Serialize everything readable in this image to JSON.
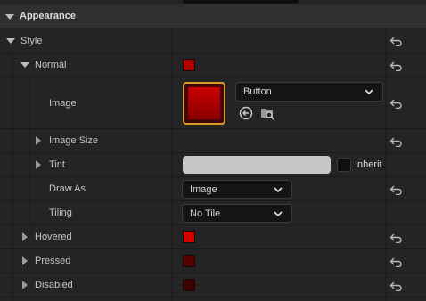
{
  "category": {
    "title": "Appearance"
  },
  "rows": {
    "style": "Style",
    "normal": "Normal",
    "image": "Image",
    "image_size": "Image Size",
    "tint": "Tint",
    "draw_as": "Draw As",
    "tiling": "Tiling",
    "hovered": "Hovered",
    "pressed": "Pressed",
    "disabled": "Disabled"
  },
  "image_asset": {
    "selected": "Button"
  },
  "draw_as": {
    "value": "Image"
  },
  "tiling": {
    "value": "No Tile"
  },
  "tint": {
    "inherit_label": "Inherit",
    "color": "#c7c7c7"
  },
  "swatches": {
    "normal": "#b30000",
    "hovered": "#d40000",
    "pressed": "#560000",
    "disabled": "#3f0000"
  },
  "icons": {
    "reset": "reset-arrow-icon",
    "browse": "browse-to-asset-icon",
    "find": "find-in-content-browser-icon",
    "expand": "expand-arrow-icon",
    "collapse": "collapse-arrow-icon",
    "chevron": "chevron-down-icon"
  }
}
